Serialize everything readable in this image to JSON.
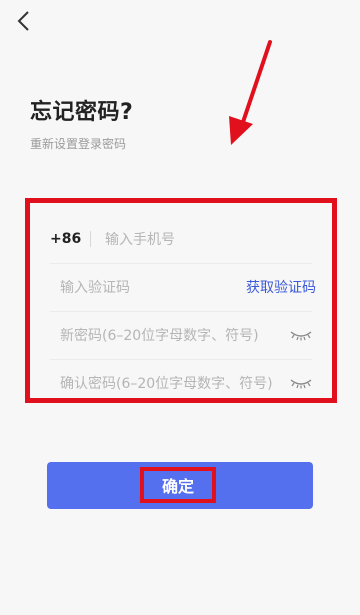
{
  "header": {
    "back_icon": "chevron-left-icon",
    "title": "忘记密码?",
    "subtitle": "重新设置登录密码"
  },
  "form": {
    "country_code": "+86",
    "phone_placeholder": "输入手机号",
    "code_placeholder": "输入验证码",
    "get_code_label": "获取验证码",
    "new_password_placeholder": "新密码(6–20位字母数字、符号)",
    "confirm_password_placeholder": "确认密码(6–20位字母数字、符号)",
    "eye_icon": "eye-closed-icon"
  },
  "confirm_button": {
    "label": "确定"
  },
  "colors": {
    "primary": "#5470ee",
    "link": "#3c5ad8",
    "annotation_red": "#e0101c",
    "background": "#f7f7f7"
  }
}
